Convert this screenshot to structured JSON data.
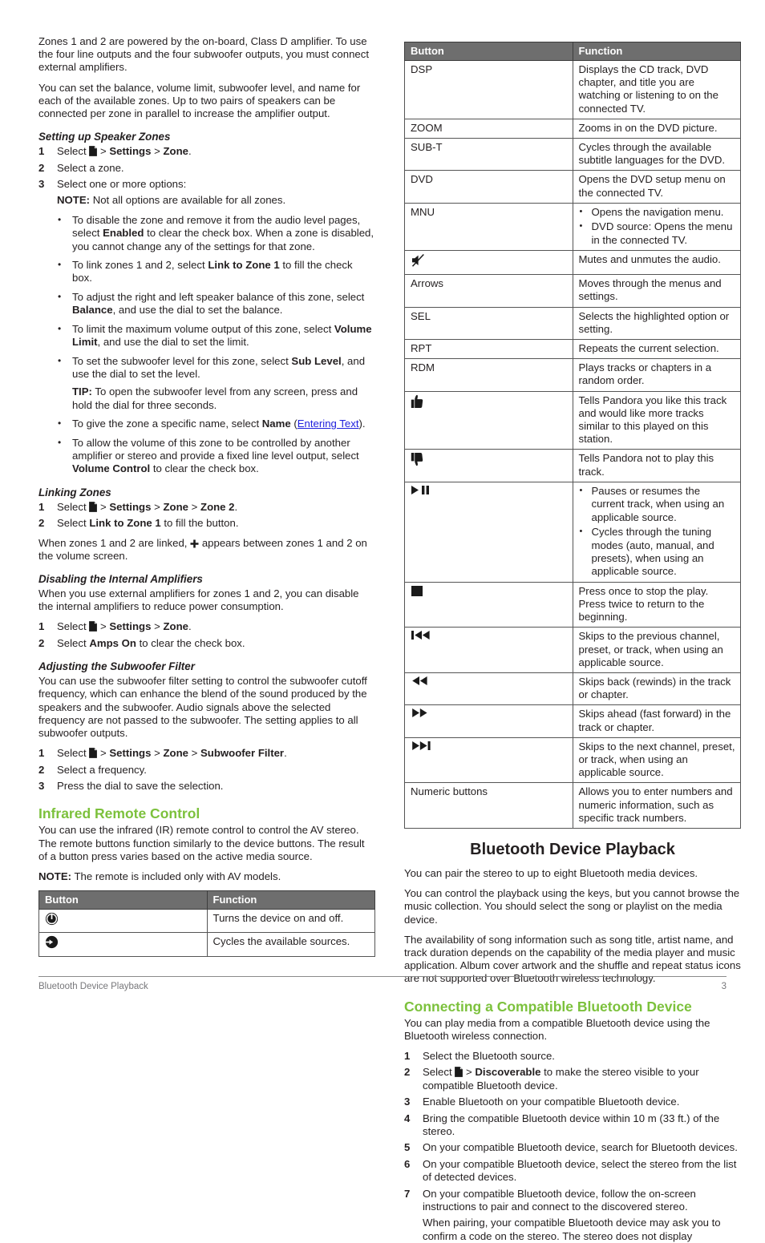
{
  "left_column": {
    "intro_paragraphs": [
      "Zones 1 and 2 are powered by the on-board, Class D amplifier. To use the four line outputs and the four subwoofer outputs, you must connect external amplifiers.",
      "You can set the balance, volume limit, subwoofer level, and name for each of the available zones. Up to two pairs of speakers can be connected per zone in parallel to increase the amplifier output."
    ],
    "setting_up_speaker_zones": {
      "heading": "Setting up Speaker Zones",
      "step1_prefix": "Select",
      "step1_sep1": ">",
      "step1_settings": "Settings",
      "step1_sep2": ">",
      "step1_zone": "Zone",
      "step1_period": ".",
      "step2": "Select a zone.",
      "step3": "Select one or more options:",
      "note_label": "NOTE:",
      "note_text": "Not all options are available for all zones.",
      "bullets": [
        {
          "pre": "To disable the zone and remove it from the audio level pages, select ",
          "bold": "Enabled",
          "post": " to clear the check box. When a zone is disabled, you cannot change any of the settings for that zone."
        },
        {
          "pre": "To link zones 1 and 2, select ",
          "bold": "Link to Zone 1",
          "post": " to fill the check box."
        },
        {
          "pre": "To adjust the right and left speaker balance of this zone, select ",
          "bold": "Balance",
          "post": ", and use the dial to set the balance."
        },
        {
          "pre": "To limit the maximum volume output of this zone, select ",
          "bold": "Volume Limit",
          "post": ", and use the dial to set the limit."
        },
        {
          "pre": "To set the subwoofer level for this zone, select ",
          "bold": "Sub Level",
          "post": ", and use the dial to set the level.",
          "tip_label": "TIP:",
          "tip_text": "To open the subwoofer level from any screen, press and hold the dial for three seconds."
        },
        {
          "pre": "To give the zone a specific name, select ",
          "bold": "Name",
          "post": " (",
          "link": "Entering Text",
          "post2": ")."
        },
        {
          "pre": "To allow the volume of this zone to be controlled by another amplifier or stereo and provide a fixed line level output, select ",
          "bold": "Volume Control",
          "post": " to clear the check box."
        }
      ]
    },
    "linking_zones": {
      "heading": "Linking Zones",
      "step1_prefix": "Select",
      "step1_sep1": ">",
      "step1_settings": "Settings",
      "step1_sep2": ">",
      "step1_zone": "Zone",
      "step1_sep3": ">",
      "step1_zone2": "Zone 2",
      "step1_period": ".",
      "step2_pre": "Select ",
      "step2_bold": "Link to Zone 1",
      "step2_post": " to fill the button.",
      "result_pre": "When zones 1 and 2 are linked,",
      "result_post": "appears between zones 1 and 2 on the volume screen."
    },
    "disabling_amplifiers": {
      "heading": "Disabling the Internal Amplifiers",
      "paragraph": "When you use external amplifiers for zones 1 and 2, you can disable the internal amplifiers to reduce power consumption.",
      "step1_prefix": "Select",
      "step1_sep1": ">",
      "step1_settings": "Settings",
      "step1_sep2": ">",
      "step1_zone": "Zone",
      "step1_period": ".",
      "step2_pre": "Select ",
      "step2_bold": "Amps On",
      "step2_post": " to clear the check box."
    },
    "subwoofer_filter": {
      "heading": "Adjusting the Subwoofer Filter",
      "paragraph": "You can use the subwoofer filter setting to control the subwoofer cutoff frequency, which can enhance the blend of the sound produced by the speakers and the subwoofer. Audio signals above the selected frequency are not passed to the subwoofer. The setting applies to all subwoofer outputs.",
      "step1_prefix": "Select",
      "step1_sep1": ">",
      "step1_settings": "Settings",
      "step1_sep2": ">",
      "step1_zone": "Zone",
      "step1_sep3": ">",
      "step1_filter": "Subwoofer Filter",
      "step1_period": ".",
      "step2": "Select a frequency.",
      "step3": "Press the dial to save the selection."
    },
    "infrared_remote": {
      "heading": "Infrared Remote Control",
      "paragraph": "You can use the infrared (IR) remote control to control the AV stereo. The remote buttons function similarly to the device buttons. The result of a button press varies based on the active media source.",
      "note_label": "NOTE:",
      "note_text": "The remote is included only with AV models.",
      "table": {
        "headers": [
          "Button",
          "Function"
        ],
        "rows": [
          {
            "icon": "power-icon",
            "function": "Turns the device on and off."
          },
          {
            "icon": "source-cycle-icon",
            "function": "Cycles the available sources."
          }
        ]
      }
    }
  },
  "right_column": {
    "remote_table": {
      "headers": [
        "Button",
        "Function"
      ],
      "rows": [
        {
          "button": "DSP",
          "function": "Displays the CD track, DVD chapter, and title you are watching or listening to on the connected TV."
        },
        {
          "button": "ZOOM",
          "function": "Zooms in on the DVD picture."
        },
        {
          "button": "SUB-T",
          "function": "Cycles through the available subtitle languages for the DVD."
        },
        {
          "button": "DVD",
          "function": "Opens the DVD setup menu on the connected TV."
        },
        {
          "button": "MNU",
          "function_bullets": [
            "Opens the navigation menu.",
            "DVD source: Opens the menu in the connected TV."
          ]
        },
        {
          "icon": "mute-icon",
          "function": "Mutes and unmutes the audio."
        },
        {
          "button": "Arrows",
          "function": "Moves through the menus and settings."
        },
        {
          "button": "SEL",
          "function": "Selects the highlighted option or setting."
        },
        {
          "button": "RPT",
          "function": "Repeats the current selection."
        },
        {
          "button": "RDM",
          "function": "Plays tracks or chapters in a random order."
        },
        {
          "icon": "thumbs-up-icon",
          "function": "Tells Pandora you like this track and would like more tracks similar to this played on this station."
        },
        {
          "icon": "thumbs-down-icon",
          "function": "Tells Pandora not to play this track."
        },
        {
          "icon": "play-pause-icon",
          "function_bullets": [
            "Pauses or resumes the current track, when using an applicable source.",
            "Cycles through the tuning modes (auto, manual, and presets), when using an applicable source."
          ]
        },
        {
          "icon": "stop-icon",
          "function_lines": [
            "Press once to stop the play.",
            "Press twice to return to the beginning."
          ]
        },
        {
          "icon": "skip-previous-icon",
          "function": "Skips to the previous channel, preset, or track, when using an applicable source."
        },
        {
          "icon": "rewind-icon",
          "function": "Skips back (rewinds) in the track or chapter."
        },
        {
          "icon": "fast-forward-icon",
          "function": "Skips ahead (fast forward) in the track or chapter."
        },
        {
          "icon": "skip-next-icon",
          "function": "Skips to the next channel, preset, or track, when using an applicable source."
        },
        {
          "button": "Numeric buttons",
          "function": "Allows you to enter numbers and numeric information, such as specific track numbers."
        }
      ]
    },
    "bluetooth_playback": {
      "heading": "Bluetooth Device Playback",
      "paragraphs": [
        "You can pair the stereo to up to eight Bluetooth media devices.",
        "You can control the playback using the keys, but you cannot browse the music collection. You should select the song or playlist on the media device.",
        "The availability of song information such as song title, artist name, and track duration depends on the capability of the media player and music application. Album cover artwork and the shuffle and repeat status icons are not supported over Bluetooth wireless technology."
      ]
    },
    "connecting_device": {
      "heading": "Connecting a Compatible Bluetooth Device",
      "paragraph": "You can play media from a compatible Bluetooth device using the Bluetooth wireless connection.",
      "step1": "Select the Bluetooth source.",
      "step2_prefix": "Select",
      "step2_sep": ">",
      "step2_bold": "Discoverable",
      "step2_post": " to make the stereo visible to your compatible Bluetooth device.",
      "step3": "Enable Bluetooth on your compatible Bluetooth device.",
      "step4": "Bring the compatible Bluetooth device within 10 m (33 ft.) of the stereo.",
      "step5": "On your compatible Bluetooth device, search for Bluetooth devices.",
      "step6": "On your compatible Bluetooth device, select the stereo from the list of detected devices.",
      "step7": "On your compatible Bluetooth device, follow the on-screen instructions to pair and connect to the discovered stereo.",
      "step7_sub": "When pairing, your compatible Bluetooth device may ask you to confirm a code on the stereo. The stereo does not display"
    }
  },
  "footer": {
    "section": "Bluetooth Device Playback",
    "page_number": "3"
  },
  "colors": {
    "heading_green": "#7cc13c",
    "link_blue": "#2020dd",
    "table_header_bg": "#6e6e6e",
    "body_text": "#231f20",
    "footer_text": "#77777a"
  }
}
